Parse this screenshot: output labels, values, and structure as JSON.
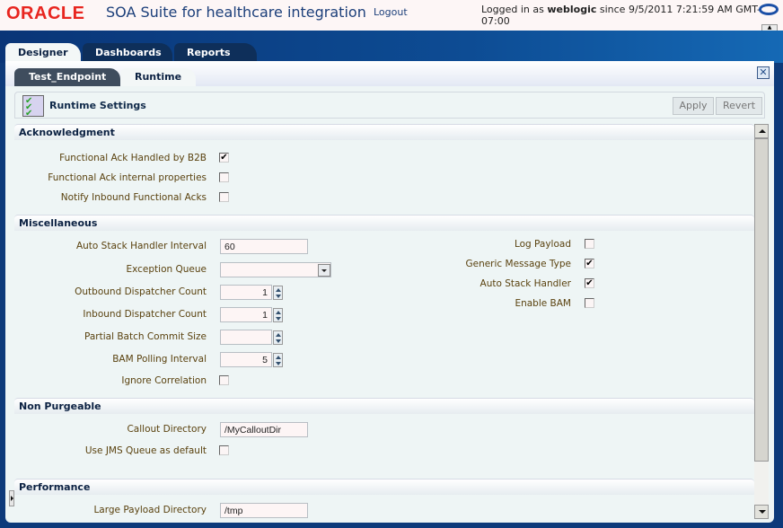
{
  "header": {
    "brand": "ORACLE",
    "product": "SOA Suite for healthcare integration",
    "logout": "Logout",
    "login_prefix": "Logged in as ",
    "user": "weblogic",
    "login_suffix": " since 9/5/2011 7:21:59 AM GMT-07:00"
  },
  "main_tabs": [
    {
      "label": "Designer",
      "active": true
    },
    {
      "label": "Dashboards",
      "active": false
    },
    {
      "label": "Reports",
      "active": false
    }
  ],
  "sub_tabs": [
    {
      "label": "Test_Endpoint",
      "active": false
    },
    {
      "label": "Runtime",
      "active": true
    }
  ],
  "toolbar": {
    "title": "Runtime Settings",
    "apply": "Apply",
    "revert": "Revert"
  },
  "sections": {
    "ack": {
      "title": "Acknowledgment",
      "fields": [
        {
          "label": "Functional Ack Handled by B2B",
          "checked": true
        },
        {
          "label": "Functional Ack internal properties",
          "checked": false
        },
        {
          "label": "Notify Inbound Functional Acks",
          "checked": false
        }
      ]
    },
    "misc": {
      "title": "Miscellaneous",
      "auto_stack_interval": {
        "label": "Auto Stack Handler Interval",
        "value": "60"
      },
      "exception_queue": {
        "label": "Exception Queue",
        "value": ""
      },
      "outbound_count": {
        "label": "Outbound Dispatcher Count",
        "value": "1"
      },
      "inbound_count": {
        "label": "Inbound Dispatcher Count",
        "value": "1"
      },
      "partial_batch": {
        "label": "Partial Batch Commit Size",
        "value": ""
      },
      "bam_polling": {
        "label": "BAM Polling Interval",
        "value": "5"
      },
      "ignore_correlation": {
        "label": "Ignore Correlation",
        "checked": false
      },
      "log_payload": {
        "label": "Log Payload",
        "checked": false
      },
      "generic_message_type": {
        "label": "Generic Message Type",
        "checked": true
      },
      "auto_stack_handler": {
        "label": "Auto Stack Handler",
        "checked": true
      },
      "enable_bam": {
        "label": "Enable BAM",
        "checked": false
      }
    },
    "nonpurge": {
      "title": "Non Purgeable",
      "callout_dir": {
        "label": "Callout Directory",
        "value": "/MyCalloutDir"
      },
      "use_jms": {
        "label": "Use JMS Queue as default",
        "checked": false
      }
    },
    "perf": {
      "title": "Performance",
      "large_payload_dir": {
        "label": "Large Payload Directory",
        "value": "/tmp"
      }
    }
  },
  "check_glyph": "✔"
}
